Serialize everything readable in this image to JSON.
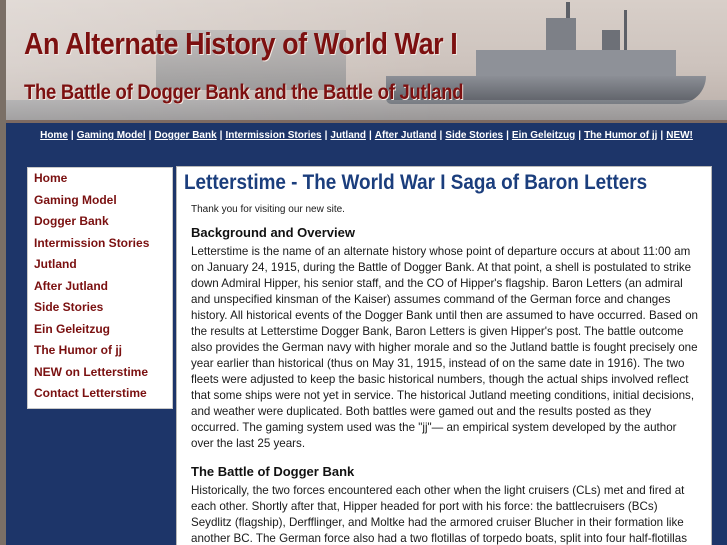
{
  "header": {
    "title": "An Alternate History of World War I",
    "subtitle": "The Battle of Dogger Bank and the Battle of Jutland"
  },
  "topnav": {
    "items": [
      "Home",
      "Gaming Model",
      "Dogger Bank",
      "Intermission Stories",
      "Jutland",
      "After Jutland",
      "Side Stories",
      "Ein Geleitzug",
      "The Humor of jj",
      "NEW!"
    ],
    "separator": "|"
  },
  "sidebar": {
    "items": [
      "Home",
      "Gaming Model",
      "Dogger Bank",
      "Intermission Stories",
      "Jutland",
      "After Jutland",
      "Side Stories",
      "Ein Geleitzug",
      "The Humor of jj",
      "NEW on Letterstime",
      "Contact Letterstime"
    ]
  },
  "main": {
    "title": "Letterstime - The World War I Saga of Baron Letters",
    "thanks": "Thank you for visiting our new site.",
    "section1_heading": "Background and Overview",
    "section1_text": "Letterstime is the name of an alternate history whose point of departure occurs at about 11:00 am on January 24, 1915, during the Battle of Dogger Bank. At that point, a shell is postulated to strike down Admiral Hipper, his senior staff, and the CO of Hipper's flagship. Baron Letters (an admiral and unspecified kinsman of the Kaiser) assumes command of the German force and changes history. All historical events of the Dogger Bank until then are assumed to have occurred. Based on the results at Letterstime Dogger Bank, Baron Letters is given Hipper's post. The battle outcome also provides the German navy with higher morale and so the Jutland battle is fought precisely one year earlier than historical (thus on May 31, 1915, instead of on the same date in 1916). The two fleets were adjusted to keep the basic historical numbers, though the actual ships involved reflect that some ships were not yet in service. The historical Jutland meeting conditions, initial decisions, and weather were duplicated. Both battles were gamed out and the results posted as they occurred. The gaming system used was the \"jj\"— an empirical system developed by the author over the last 25 years.",
    "section2_heading": "The Battle of Dogger Bank",
    "section2_text": "Historically, the two forces encountered each other when the light cruisers (CLs) met and fired at each other. Shortly after that, Hipper headed for port with his force: the battlecruisers (BCs) Seydlitz (flagship), Derfflinger, and Moltke had the armored cruiser Blucher in their formation like another BC. The German force also had a two flotillas of torpedo boats, split into four half-flotillas"
  }
}
